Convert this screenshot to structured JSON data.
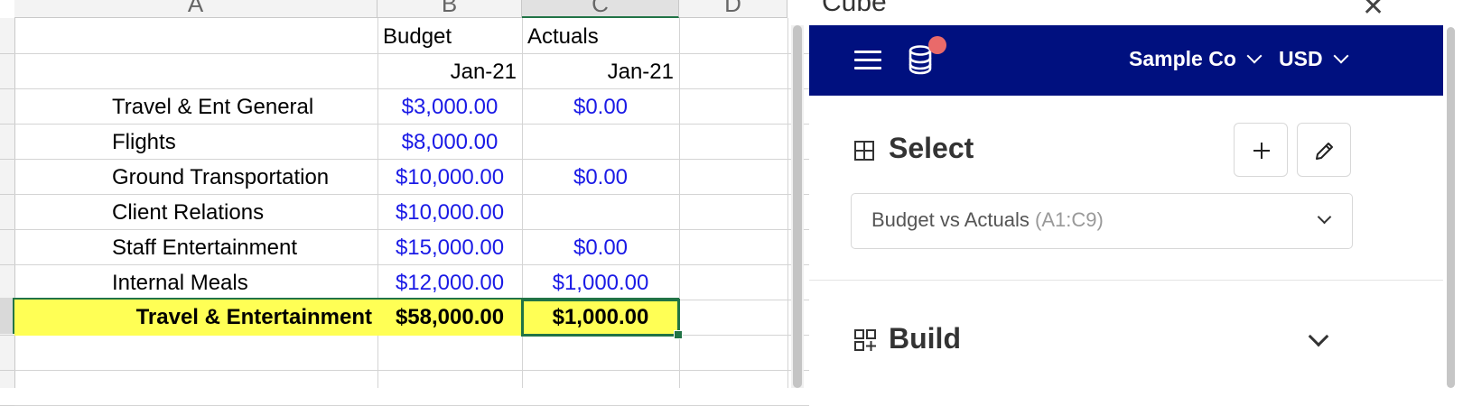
{
  "spreadsheet": {
    "columns": [
      "A",
      "B",
      "C",
      "D"
    ],
    "selected_column": "C",
    "header_row": {
      "budget": "Budget",
      "actuals": "Actuals"
    },
    "date_row": {
      "budget_date": "Jan-21",
      "actuals_date": "Jan-21"
    },
    "rows": [
      {
        "label": "Travel & Ent General",
        "budget": "$3,000.00",
        "actual": "$0.00"
      },
      {
        "label": "Flights",
        "budget": "$8,000.00",
        "actual": ""
      },
      {
        "label": "Ground Transportation",
        "budget": "$10,000.00",
        "actual": "$0.00"
      },
      {
        "label": "Client Relations",
        "budget": "$10,000.00",
        "actual": ""
      },
      {
        "label": "Staff Entertainment",
        "budget": "$15,000.00",
        "actual": "$0.00"
      },
      {
        "label": "Internal Meals",
        "budget": "$12,000.00",
        "actual": "$1,000.00"
      }
    ],
    "total_row": {
      "label": "Travel & Entertainment",
      "budget": "$58,000.00",
      "actual": "$1,000.00"
    },
    "colors": {
      "input_blue": "#1a1ae6",
      "highlight_yellow": "#ffff55",
      "selection_green": "#217346"
    }
  },
  "panel": {
    "title": "Cube",
    "close_icon": "close-icon",
    "topbar": {
      "menu_icon": "hamburger-menu-icon",
      "db_icon": "database-icon",
      "company": "Sample Co",
      "currency": "USD",
      "background": "#00107f",
      "notification_color": "#e96a6a"
    },
    "select_section": {
      "title": "Select",
      "icon": "table-grid-icon",
      "add_icon": "plus-icon",
      "edit_icon": "pencil-icon",
      "dropdown_value": "Budget vs Actuals",
      "dropdown_range": "(A1:C9)"
    },
    "build_section": {
      "title": "Build",
      "icon": "build-grid-icon"
    }
  }
}
